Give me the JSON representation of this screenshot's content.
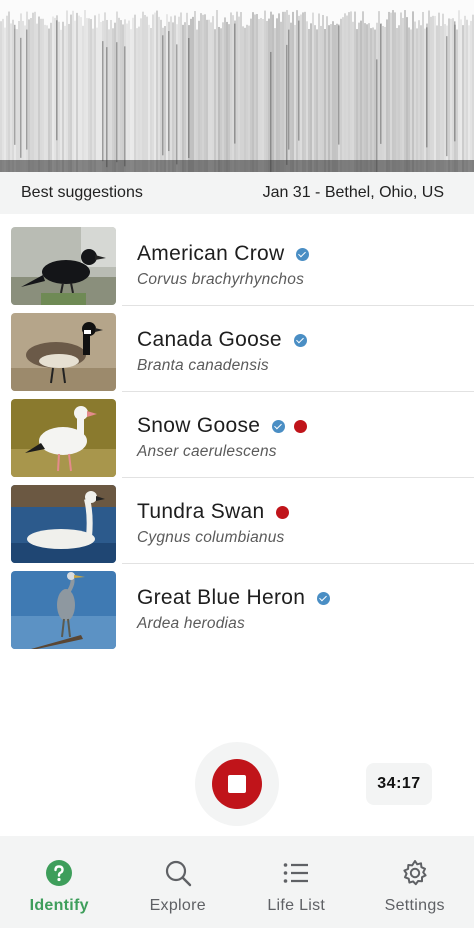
{
  "header": {
    "suggestions_label": "Best suggestions",
    "date_location": "Jan 31 - Bethel, Ohio, US"
  },
  "species": [
    {
      "common": "American Crow",
      "scientific": "Corvus brachyrhynchos",
      "verified": true,
      "rare": false,
      "photo_icon": "american-crow-photo"
    },
    {
      "common": "Canada Goose",
      "scientific": "Branta canadensis",
      "verified": true,
      "rare": false,
      "photo_icon": "canada-goose-photo"
    },
    {
      "common": "Snow Goose",
      "scientific": "Anser caerulescens",
      "verified": true,
      "rare": true,
      "photo_icon": "snow-goose-photo"
    },
    {
      "common": "Tundra Swan",
      "scientific": "Cygnus columbianus",
      "verified": false,
      "rare": true,
      "photo_icon": "tundra-swan-photo"
    },
    {
      "common": "Great Blue Heron",
      "scientific": "Ardea herodias",
      "verified": true,
      "rare": false,
      "photo_icon": "great-blue-heron-photo"
    }
  ],
  "recorder": {
    "timer": "34:17",
    "record_color": "#c0141a"
  },
  "tabs": [
    {
      "label": "Identify",
      "icon": "question-circle-icon",
      "active": true
    },
    {
      "label": "Explore",
      "icon": "search-icon",
      "active": false
    },
    {
      "label": "Life List",
      "icon": "list-icon",
      "active": false
    },
    {
      "label": "Settings",
      "icon": "gear-icon",
      "active": false
    }
  ],
  "colors": {
    "accent_green": "#3e9e5b",
    "verified_blue": "#4a8ec4",
    "rare_red": "#c0141a"
  }
}
